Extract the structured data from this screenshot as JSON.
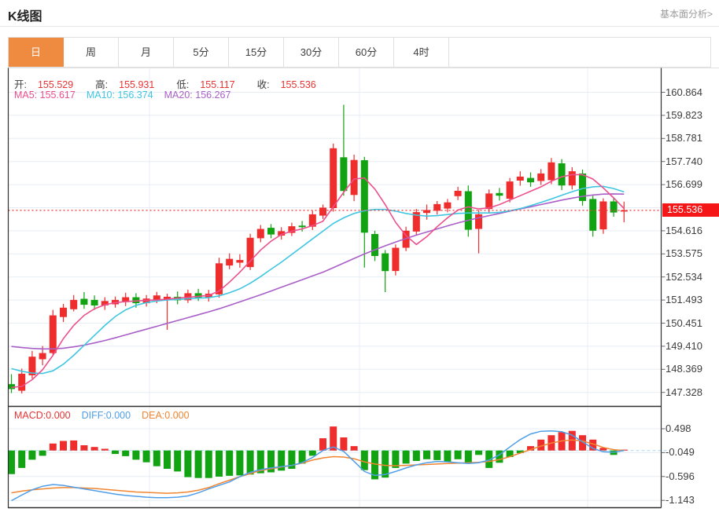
{
  "header": {
    "title": "K线图",
    "link": "基本面分析>"
  },
  "tabs": [
    {
      "key": "day",
      "label": "日",
      "active": true
    },
    {
      "key": "week",
      "label": "周",
      "active": false
    },
    {
      "key": "month",
      "label": "月",
      "active": false
    },
    {
      "key": "5min",
      "label": "5分",
      "active": false
    },
    {
      "key": "15min",
      "label": "15分",
      "active": false
    },
    {
      "key": "30min",
      "label": "30分",
      "active": false
    },
    {
      "key": "60min",
      "label": "60分",
      "active": false
    },
    {
      "key": "4hour",
      "label": "4时",
      "active": false
    }
  ],
  "legend": {
    "ohlc": [
      {
        "key": "open",
        "label": "开",
        "value": "155.529"
      },
      {
        "key": "high",
        "label": "高",
        "value": "155.931"
      },
      {
        "key": "low",
        "label": "低",
        "value": "155.117"
      },
      {
        "key": "close",
        "label": "收",
        "value": "155.536"
      }
    ],
    "ma": [
      {
        "name": "MA5",
        "value": "155.617",
        "color": "#ec4f8c"
      },
      {
        "name": "MA10",
        "value": "156.374",
        "color": "#3fc6e0"
      },
      {
        "name": "MA20",
        "value": "156.267",
        "color": "#a95fc8"
      }
    ],
    "macd": [
      {
        "name": "MACD",
        "value": "0.000",
        "color": "#e83333"
      },
      {
        "name": "DIFF",
        "value": "0.000",
        "color": "#4f9ee8"
      },
      {
        "name": "DEA",
        "value": "0.000",
        "color": "#f08532"
      }
    ]
  },
  "colors": {
    "up": "#ef2d2d",
    "down": "#12a312",
    "badge": "#f51717",
    "price_line": "#f23535",
    "ma5": "#ec4f8c",
    "ma10": "#3fc6e0",
    "ma20": "#a95fc8",
    "diff": "#4f9ee8",
    "dea": "#f08532",
    "accent": "#ef8a41",
    "ohlc_value": "#e83333",
    "grid": "#e7edf4",
    "frame_dark": "#2f2f2f",
    "frame_light": "#e2e2e2",
    "zero_dash": "#a8d8ea"
  },
  "chart_data": {
    "type": "candlestick+macd",
    "title": "K线图",
    "legend_position": "top-left",
    "grid": true,
    "main": {
      "ylim": [
        146.6,
        161.9
      ],
      "y_tick_max": 160.864,
      "y_tick_step": 1.0413,
      "y_tick_count": 14,
      "y_ticks_visible": [
        160.864,
        159.823,
        158.781,
        157.74,
        156.699,
        154.616,
        153.575,
        152.534,
        151.493,
        150.451,
        149.41,
        148.369,
        147.328
      ],
      "price_line": {
        "value": 155.536,
        "label": "155.536"
      }
    },
    "candles_ochl": [
      [
        147.7,
        147.48,
        148.15,
        147.3
      ],
      [
        147.4,
        148.17,
        148.4,
        147.28
      ],
      [
        148.1,
        148.94,
        149.2,
        147.95
      ],
      [
        148.82,
        149.1,
        149.42,
        148.55
      ],
      [
        149.1,
        150.8,
        151.05,
        149.0
      ],
      [
        150.73,
        151.15,
        151.32,
        150.5
      ],
      [
        151.08,
        151.5,
        151.72,
        150.98
      ],
      [
        151.55,
        151.28,
        151.85,
        151.1
      ],
      [
        151.5,
        151.25,
        151.7,
        151.05
      ],
      [
        151.25,
        151.45,
        151.62,
        151.05
      ],
      [
        151.3,
        151.5,
        151.65,
        151.15
      ],
      [
        151.4,
        151.62,
        151.82,
        151.22
      ],
      [
        151.62,
        151.35,
        151.8,
        151.15
      ],
      [
        151.35,
        151.56,
        151.72,
        151.2
      ],
      [
        151.5,
        151.7,
        151.86,
        151.35
      ],
      [
        151.48,
        151.64,
        151.78,
        150.15
      ],
      [
        151.64,
        151.48,
        151.88,
        151.3
      ],
      [
        151.48,
        151.8,
        151.96,
        151.36
      ],
      [
        151.8,
        151.6,
        152.0,
        151.45
      ],
      [
        151.62,
        151.78,
        151.95,
        151.42
      ],
      [
        151.75,
        153.15,
        153.4,
        151.6
      ],
      [
        153.05,
        153.35,
        153.6,
        152.88
      ],
      [
        153.18,
        153.3,
        153.56,
        152.95
      ],
      [
        152.98,
        154.3,
        154.48,
        152.85
      ],
      [
        154.28,
        154.7,
        154.88,
        154.1
      ],
      [
        154.75,
        154.45,
        154.92,
        154.28
      ],
      [
        154.4,
        154.6,
        154.78,
        154.22
      ],
      [
        154.52,
        154.82,
        154.98,
        154.38
      ],
      [
        154.85,
        154.78,
        155.06,
        154.58
      ],
      [
        154.8,
        155.36,
        155.52,
        154.65
      ],
      [
        155.3,
        155.66,
        155.8,
        155.15
      ],
      [
        155.64,
        158.34,
        158.55,
        155.48
      ],
      [
        157.93,
        156.41,
        160.3,
        156.2
      ],
      [
        156.23,
        157.81,
        158.05,
        155.95
      ],
      [
        157.8,
        154.53,
        157.95,
        152.96
      ],
      [
        154.47,
        153.48,
        154.62,
        153.25
      ],
      [
        153.6,
        152.8,
        153.75,
        151.85
      ],
      [
        152.8,
        153.85,
        154.0,
        152.6
      ],
      [
        153.85,
        154.62,
        154.8,
        153.7
      ],
      [
        154.58,
        155.46,
        155.6,
        154.4
      ],
      [
        155.42,
        155.55,
        155.8,
        155.12
      ],
      [
        155.52,
        155.82,
        155.96,
        155.35
      ],
      [
        155.62,
        155.9,
        156.05,
        155.45
      ],
      [
        156.18,
        156.42,
        156.6,
        156.0
      ],
      [
        156.4,
        154.66,
        156.66,
        154.35
      ],
      [
        154.7,
        155.36,
        155.55,
        153.6
      ],
      [
        155.6,
        156.3,
        156.48,
        155.42
      ],
      [
        156.32,
        156.2,
        156.55,
        155.98
      ],
      [
        156.06,
        156.84,
        157.0,
        155.9
      ],
      [
        156.88,
        157.06,
        157.3,
        156.65
      ],
      [
        157.0,
        156.8,
        157.25,
        156.6
      ],
      [
        156.86,
        157.2,
        157.4,
        156.68
      ],
      [
        156.9,
        157.7,
        157.9,
        156.72
      ],
      [
        157.66,
        156.66,
        157.85,
        156.45
      ],
      [
        156.66,
        157.3,
        157.48,
        156.48
      ],
      [
        157.2,
        155.96,
        157.38,
        155.75
      ],
      [
        156.05,
        154.62,
        156.2,
        154.35
      ],
      [
        154.68,
        155.94,
        156.08,
        154.48
      ],
      [
        155.94,
        155.44,
        156.12,
        155.25
      ],
      [
        155.5,
        155.54,
        155.93,
        155.0
      ]
    ],
    "ma5": [
      147.55,
      147.6,
      147.9,
      148.35,
      149.0,
      149.75,
      150.35,
      150.8,
      151.1,
      151.28,
      151.38,
      151.42,
      151.45,
      151.48,
      151.5,
      151.53,
      151.58,
      151.62,
      151.66,
      151.7,
      151.9,
      152.3,
      152.75,
      153.25,
      153.75,
      154.15,
      154.45,
      154.6,
      154.7,
      154.85,
      155.05,
      155.7,
      156.35,
      156.95,
      157.0,
      156.5,
      155.8,
      155.0,
      154.4,
      154.0,
      154.35,
      154.8,
      155.2,
      155.55,
      155.7,
      155.6,
      155.65,
      155.8,
      156.0,
      156.2,
      156.4,
      156.6,
      156.85,
      157.05,
      157.15,
      157.15,
      156.95,
      156.55,
      156.1,
      155.62
    ],
    "ma10": [
      148.4,
      148.28,
      148.2,
      148.18,
      148.3,
      148.6,
      149.0,
      149.45,
      149.9,
      150.35,
      150.75,
      151.05,
      151.25,
      151.38,
      151.45,
      151.5,
      151.52,
      151.55,
      151.58,
      151.6,
      151.68,
      151.82,
      152.0,
      152.25,
      152.55,
      152.88,
      153.2,
      153.55,
      153.9,
      154.25,
      154.6,
      154.95,
      155.2,
      155.4,
      155.52,
      155.58,
      155.58,
      155.5,
      155.4,
      155.32,
      155.28,
      155.3,
      155.35,
      155.4,
      155.42,
      155.42,
      155.42,
      155.45,
      155.52,
      155.62,
      155.75,
      155.9,
      156.05,
      156.22,
      156.38,
      156.52,
      156.6,
      156.62,
      156.52,
      156.37
    ],
    "ma20": [
      149.4,
      149.35,
      149.31,
      149.29,
      149.29,
      149.32,
      149.38,
      149.46,
      149.56,
      149.67,
      149.79,
      149.92,
      150.05,
      150.18,
      150.31,
      150.44,
      150.57,
      150.7,
      150.83,
      150.96,
      151.1,
      151.25,
      151.41,
      151.57,
      151.73,
      151.9,
      152.07,
      152.24,
      152.41,
      152.58,
      152.75,
      152.95,
      153.16,
      153.37,
      153.57,
      153.76,
      153.94,
      154.11,
      154.27,
      154.42,
      154.56,
      154.7,
      154.84,
      154.97,
      155.09,
      155.2,
      155.3,
      155.4,
      155.5,
      155.6,
      155.7,
      155.8,
      155.9,
      156.0,
      156.09,
      156.17,
      156.23,
      156.27,
      156.28,
      156.27
    ],
    "macd": {
      "y_ticks": [
        0.498,
        -0.049,
        -0.596,
        -1.143
      ],
      "zero_line": 0,
      "histogram": [
        -0.54,
        -0.4,
        -0.21,
        -0.12,
        0.16,
        0.22,
        0.23,
        0.12,
        0.08,
        0.04,
        -0.08,
        -0.13,
        -0.21,
        -0.27,
        -0.36,
        -0.42,
        -0.48,
        -0.61,
        -0.63,
        -0.63,
        -0.6,
        -0.58,
        -0.57,
        -0.55,
        -0.52,
        -0.5,
        -0.46,
        -0.42,
        -0.3,
        -0.12,
        0.28,
        0.55,
        0.3,
        0.1,
        -0.45,
        -0.66,
        -0.62,
        -0.4,
        -0.3,
        -0.24,
        -0.2,
        -0.22,
        -0.26,
        -0.2,
        -0.3,
        -0.1,
        -0.4,
        -0.28,
        -0.15,
        -0.06,
        0.1,
        0.25,
        0.35,
        0.42,
        0.45,
        0.35,
        0.25,
        0.06,
        -0.1,
        0.02
      ],
      "diff": [
        -1.15,
        -1.02,
        -0.9,
        -0.82,
        -0.78,
        -0.8,
        -0.84,
        -0.88,
        -0.92,
        -0.96,
        -1.0,
        -1.03,
        -1.05,
        -1.07,
        -1.08,
        -1.08,
        -1.07,
        -1.04,
        -0.97,
        -0.88,
        -0.8,
        -0.72,
        -0.6,
        -0.5,
        -0.44,
        -0.4,
        -0.37,
        -0.34,
        -0.28,
        -0.16,
        0.0,
        0.08,
        -0.02,
        -0.25,
        -0.48,
        -0.57,
        -0.55,
        -0.48,
        -0.4,
        -0.33,
        -0.28,
        -0.25,
        -0.26,
        -0.28,
        -0.3,
        -0.28,
        -0.22,
        -0.1,
        0.08,
        0.25,
        0.38,
        0.44,
        0.45,
        0.43,
        0.35,
        0.2,
        0.05,
        -0.03,
        -0.04,
        0.0
      ],
      "dea": [
        -0.97,
        -0.93,
        -0.9,
        -0.88,
        -0.86,
        -0.85,
        -0.85,
        -0.86,
        -0.87,
        -0.89,
        -0.91,
        -0.93,
        -0.95,
        -0.96,
        -0.97,
        -0.98,
        -0.97,
        -0.95,
        -0.91,
        -0.85,
        -0.76,
        -0.68,
        -0.6,
        -0.53,
        -0.46,
        -0.42,
        -0.38,
        -0.34,
        -0.29,
        -0.22,
        -0.17,
        -0.14,
        -0.15,
        -0.19,
        -0.26,
        -0.31,
        -0.34,
        -0.35,
        -0.34,
        -0.33,
        -0.32,
        -0.31,
        -0.3,
        -0.29,
        -0.28,
        -0.27,
        -0.25,
        -0.21,
        -0.14,
        -0.06,
        0.02,
        0.1,
        0.17,
        0.22,
        0.24,
        0.22,
        0.15,
        0.07,
        0.02,
        0.0
      ]
    }
  }
}
